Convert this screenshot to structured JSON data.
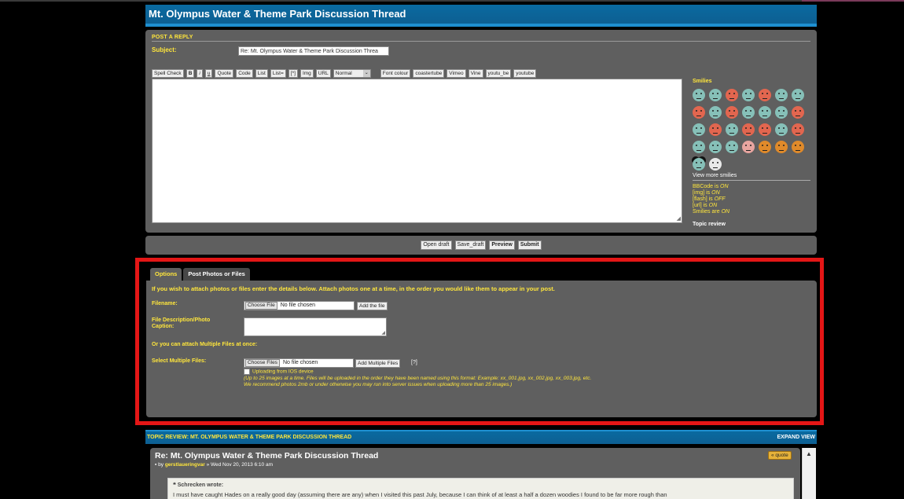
{
  "thread_title": "Mt. Olympus Water & Theme Park Discussion Thread",
  "reply": {
    "header": "POST A REPLY",
    "subject_label": "Subject:",
    "subject_value": "Re: Mt. Olympus Water & Theme Park Discussion Threa",
    "toolbar": [
      "Spell Check",
      "B",
      "i",
      "u",
      "Quote",
      "Code",
      "List",
      "List=",
      "[*]",
      "Img",
      "URL"
    ],
    "font_size": "Normal",
    "toolbar2": [
      "Font colour",
      "coastertube",
      "Vimeo",
      "Vine",
      "youtu_be",
      "youtube"
    ]
  },
  "sidebar": {
    "smilies_title": "Smilies",
    "view_more": "View more smilies",
    "bbcode": [
      {
        "label": "BBCode is ",
        "state": "ON"
      },
      {
        "label": "[img] is ",
        "state": "ON"
      },
      {
        "label": "[flash] is ",
        "state": "OFF"
      },
      {
        "label": "[url] is ",
        "state": "ON"
      },
      {
        "label": "Smilies are ",
        "state": "ON"
      }
    ],
    "topic_review": "Topic review"
  },
  "buttons": [
    "Open draft",
    "Save_draft",
    "Preview",
    "Submit"
  ],
  "tabs": {
    "options": "Options",
    "post_photos": "Post Photos or Files"
  },
  "attach": {
    "intro": "If you wish to attach photos or files enter the details below. Attach photos one at a time, in the order you would like them to appear in your post.",
    "filename_label": "Filename:",
    "choose_file": "Choose File",
    "no_file": "No file chosen",
    "add_file": "Add the file",
    "desc_label": "File Description/Photo Caption:",
    "multi_intro": "Or you can attach Multiple Files at once:",
    "select_multi_label": "Select Multiple Files:",
    "choose_files": "Choose Files",
    "add_multiple": "Add Multiple Files",
    "help": "[?]",
    "ios": "Uploading from IOS device",
    "note1": "(Up to 25 images at a time. Files will be uploaded in the order they have been named using this format: Example: xx_001.jpg, xx_002.jpg, xx_003.jpg, etc.",
    "note2": "We recommend photos 2mb or under otherwise you may run into server issues when uploading more than 25 images.)"
  },
  "review": {
    "bar_title": "TOPIC REVIEW: MT. OLYMPUS WATER & THEME PARK DISCUSSION THREAD",
    "expand": "EXPAND VIEW",
    "post_title": "Re: Mt. Olympus Water & Theme Park Discussion Thread",
    "by": "by",
    "author": "gerstlaueringvar",
    "date": "» Wed Nov 20, 2013 6:10 am",
    "quote_btn": "« quote",
    "quote_author": "Schrecken wrote:",
    "quote_text": "I must have caught Hades on a really good day (assuming there are any) when I visited this past July, because I can think of at least a half a dozen woodies I found to be far more rough than"
  },
  "colors": {
    "accent_blue": "#0d5f92",
    "yellow": "#ffe63c",
    "panel_gray": "#5f5f5f",
    "highlight_red": "#e41616"
  }
}
